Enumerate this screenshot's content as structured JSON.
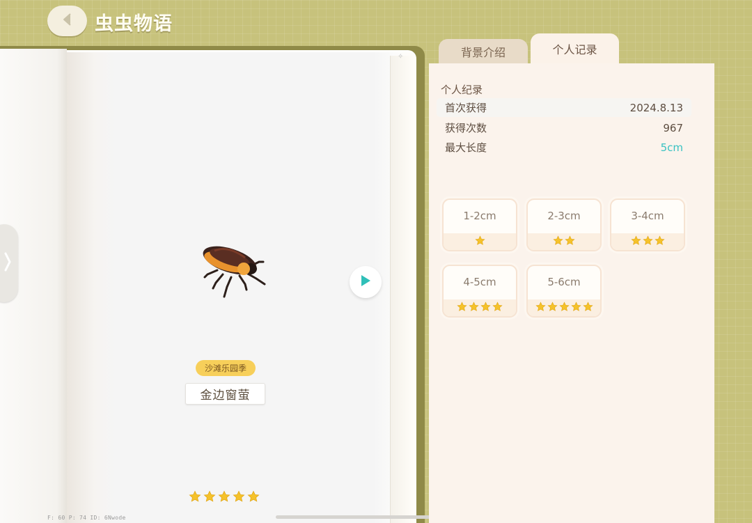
{
  "header": {
    "title": "虫虫物语",
    "back_icon": "chevron-left-icon"
  },
  "tabs": [
    {
      "label": "背景介绍",
      "active": false
    },
    {
      "label": "个人记录",
      "active": true
    }
  ],
  "bug": {
    "season_badge": "沙滩乐园季",
    "name": "金边窗萤",
    "rarity_stars": 5
  },
  "record": {
    "section_title": "个人纪录",
    "rows": [
      {
        "label": "首次获得",
        "value": "2024.8.13"
      },
      {
        "label": "获得次数",
        "value": "967"
      },
      {
        "label": "最大长度",
        "value": "5cm"
      }
    ]
  },
  "size_tiers": [
    {
      "label": "1-2cm",
      "stars": 1
    },
    {
      "label": "2-3cm",
      "stars": 2
    },
    {
      "label": "3-4cm",
      "stars": 3
    },
    {
      "label": "4-5cm",
      "stars": 4
    },
    {
      "label": "5-6cm",
      "stars": 5
    }
  ],
  "debug_text": "F: 60    P: 74    ID: 6Nwode",
  "colors": {
    "accent_teal": "#39c2c2",
    "star_gold": "#f5c22b",
    "badge_yellow": "#f7cf5a"
  }
}
